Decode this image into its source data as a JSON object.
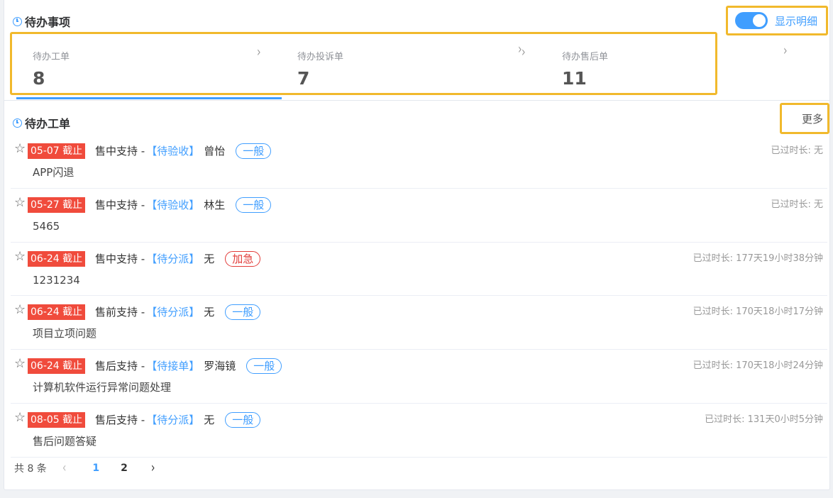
{
  "todo": {
    "title": "待办事项"
  },
  "toggle": {
    "label": "显示明细",
    "on": true
  },
  "stats": [
    {
      "label": "待办工单",
      "value": "8"
    },
    {
      "label": "待办投诉单",
      "value": "7"
    },
    {
      "label": "待办售后单",
      "value": "11"
    }
  ],
  "orders": {
    "title": "待办工单",
    "more": "更多"
  },
  "items": [
    {
      "deadline": "05-07 截止",
      "type": "售中支持 -",
      "status": "【待验收】",
      "person": "曾怡",
      "tag": "一般",
      "urgent": false,
      "subtitle": "APP闪退",
      "elapsed": "已过时长: 无"
    },
    {
      "deadline": "05-27 截止",
      "type": "售中支持 -",
      "status": "【待验收】",
      "person": "林生",
      "tag": "一般",
      "urgent": false,
      "subtitle": "5465",
      "elapsed": "已过时长: 无"
    },
    {
      "deadline": "06-24 截止",
      "type": "售中支持 -",
      "status": "【待分派】",
      "person": "无",
      "tag": "加急",
      "urgent": true,
      "subtitle": "1231234",
      "elapsed": "已过时长: 177天19小时38分钟"
    },
    {
      "deadline": "06-24 截止",
      "type": "售前支持 -",
      "status": "【待分派】",
      "person": "无",
      "tag": "一般",
      "urgent": false,
      "subtitle": "项目立项问题",
      "elapsed": "已过时长: 170天18小时17分钟"
    },
    {
      "deadline": "06-24 截止",
      "type": "售后支持 -",
      "status": "【待接单】",
      "person": "罗海镜",
      "tag": "一般",
      "urgent": false,
      "subtitle": "计算机软件运行异常问题处理",
      "elapsed": "已过时长: 170天18小时24分钟"
    },
    {
      "deadline": "08-05 截止",
      "type": "售后支持 -",
      "status": "【待分派】",
      "person": "无",
      "tag": "一般",
      "urgent": false,
      "subtitle": "售后问题答疑",
      "elapsed": "已过时长: 131天0小时5分钟"
    }
  ],
  "pager": {
    "total": "共 8 条",
    "prev": "‹",
    "page1": "1",
    "page2": "2",
    "next": "›"
  },
  "icons": {
    "star": "☆",
    "arrow": "›"
  },
  "colors": {
    "accent": "#409eff",
    "deadline": "#f04b3c",
    "urgent": "#e23c39",
    "highlight": "#f1b92c"
  }
}
